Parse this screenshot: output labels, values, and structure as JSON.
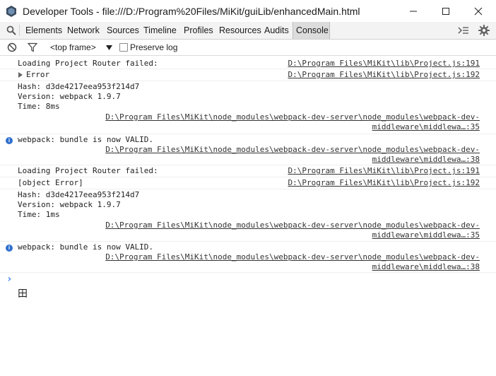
{
  "window": {
    "title": "Developer Tools - file:///D:/Program%20Files/MiKit/guiLib/enhancedMain.html",
    "icon": "devtools-app-icon"
  },
  "toolbar": {
    "tabs": [
      {
        "label": "Elements"
      },
      {
        "label": "Network"
      },
      {
        "label": "Sources"
      },
      {
        "label": "Timeline"
      },
      {
        "label": "Profiles"
      },
      {
        "label": "Resources"
      },
      {
        "label": "Audits"
      },
      {
        "label": "Console",
        "selected": true
      }
    ]
  },
  "filterbar": {
    "frame_select": "<top frame>",
    "preserve_log_label": "Preserve log",
    "preserve_log_checked": false
  },
  "console": {
    "messages": [
      {
        "text": "Loading Project Router failed:",
        "source": "D:\\Program Files\\MiKit\\lib\\Project.js:191"
      },
      {
        "text": "Error",
        "expandable": true,
        "source": "D:\\Program Files\\MiKit\\lib\\Project.js:192"
      },
      {
        "lines": [
          "Hash: d3de4217eea953f214d7",
          "Version: webpack 1.9.7",
          "Time: 8ms"
        ],
        "source_lines": [
          "D:\\Program Files\\MiKit\\node_modules\\webpack-dev-server\\node_modules\\webpack-dev-",
          "middleware\\middlewa…:35"
        ]
      },
      {
        "level": "info",
        "text": "webpack: bundle is now VALID.",
        "source_lines": [
          "D:\\Program Files\\MiKit\\node_modules\\webpack-dev-server\\node_modules\\webpack-dev-",
          "middleware\\middlewa…:38"
        ]
      },
      {
        "text": "Loading Project Router failed:",
        "source": "D:\\Program Files\\MiKit\\lib\\Project.js:191"
      },
      {
        "text": "[object Error]",
        "source": "D:\\Program Files\\MiKit\\lib\\Project.js:192"
      },
      {
        "lines": [
          "Hash: d3de4217eea953f214d7",
          "Version: webpack 1.9.7",
          "Time: 1ms"
        ],
        "source_lines": [
          "D:\\Program Files\\MiKit\\node_modules\\webpack-dev-server\\node_modules\\webpack-dev-",
          "middleware\\middlewa…:35"
        ]
      },
      {
        "level": "info",
        "text": "webpack: bundle is now VALID.",
        "source_lines": [
          "D:\\Program Files\\MiKit\\node_modules\\webpack-dev-server\\node_modules\\webpack-dev-",
          "middleware\\middlewa…:38"
        ]
      }
    ],
    "prompt_symbol": "›",
    "ime_indicator": "田"
  },
  "colors": {
    "toolbar_bg": "#f3f3f3",
    "info_blue": "#2e6fce",
    "prompt_blue": "#367cf1"
  }
}
